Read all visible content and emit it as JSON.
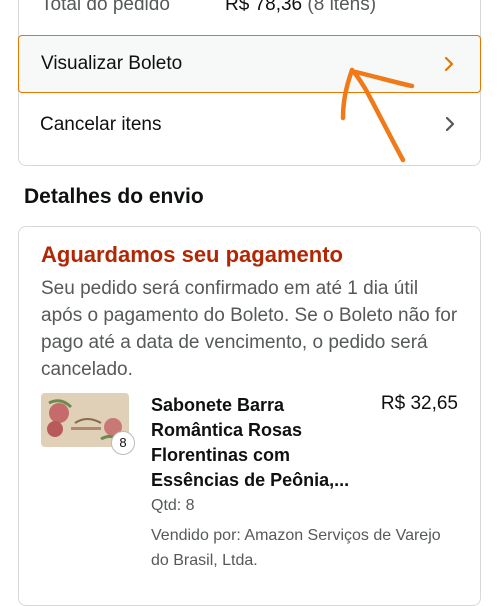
{
  "order_summary": {
    "total_label": "Total do pedido",
    "total_value": "R$ 78,36",
    "total_count": "(8 itens)"
  },
  "actions": {
    "view_boleto": "Visualizar Boleto",
    "cancel_items": "Cancelar itens"
  },
  "shipping": {
    "section_title": "Detalhes do envio",
    "status_title": "Aguardamos seu pagamento",
    "status_description": "Seu pedido será confirmado em até 1 dia útil após o pagamento do Boleto. Se o Boleto não for pago até a data de vencimento, o pedido será cancelado.",
    "item": {
      "name": "Sabonete Barra Romântica Rosas Florentinas com Essências de Peônia,...",
      "price": "R$ 32,65",
      "quantity_badge": "8",
      "quantity": "Qtd: 8",
      "seller": "Vendido por: Amazon Serviços de Varejo do Brasil, Ltda."
    }
  },
  "colors": {
    "status_red": "#b12704",
    "highlight_orange": "#e77600",
    "annotation_orange": "#f07a1a"
  },
  "icons": [
    "chevron-right-icon",
    "product-thumbnail",
    "hand-drawn-arrow"
  ]
}
